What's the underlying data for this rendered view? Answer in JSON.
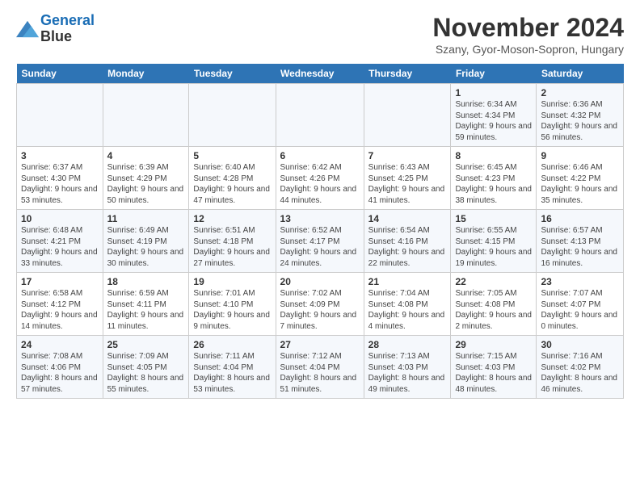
{
  "logo": {
    "line1": "General",
    "line2": "Blue"
  },
  "title": "November 2024",
  "subtitle": "Szany, Gyor-Moson-Sopron, Hungary",
  "days_of_week": [
    "Sunday",
    "Monday",
    "Tuesday",
    "Wednesday",
    "Thursday",
    "Friday",
    "Saturday"
  ],
  "weeks": [
    [
      {
        "num": "",
        "detail": ""
      },
      {
        "num": "",
        "detail": ""
      },
      {
        "num": "",
        "detail": ""
      },
      {
        "num": "",
        "detail": ""
      },
      {
        "num": "",
        "detail": ""
      },
      {
        "num": "1",
        "detail": "Sunrise: 6:34 AM\nSunset: 4:34 PM\nDaylight: 9 hours and 59 minutes."
      },
      {
        "num": "2",
        "detail": "Sunrise: 6:36 AM\nSunset: 4:32 PM\nDaylight: 9 hours and 56 minutes."
      }
    ],
    [
      {
        "num": "3",
        "detail": "Sunrise: 6:37 AM\nSunset: 4:30 PM\nDaylight: 9 hours and 53 minutes."
      },
      {
        "num": "4",
        "detail": "Sunrise: 6:39 AM\nSunset: 4:29 PM\nDaylight: 9 hours and 50 minutes."
      },
      {
        "num": "5",
        "detail": "Sunrise: 6:40 AM\nSunset: 4:28 PM\nDaylight: 9 hours and 47 minutes."
      },
      {
        "num": "6",
        "detail": "Sunrise: 6:42 AM\nSunset: 4:26 PM\nDaylight: 9 hours and 44 minutes."
      },
      {
        "num": "7",
        "detail": "Sunrise: 6:43 AM\nSunset: 4:25 PM\nDaylight: 9 hours and 41 minutes."
      },
      {
        "num": "8",
        "detail": "Sunrise: 6:45 AM\nSunset: 4:23 PM\nDaylight: 9 hours and 38 minutes."
      },
      {
        "num": "9",
        "detail": "Sunrise: 6:46 AM\nSunset: 4:22 PM\nDaylight: 9 hours and 35 minutes."
      }
    ],
    [
      {
        "num": "10",
        "detail": "Sunrise: 6:48 AM\nSunset: 4:21 PM\nDaylight: 9 hours and 33 minutes."
      },
      {
        "num": "11",
        "detail": "Sunrise: 6:49 AM\nSunset: 4:19 PM\nDaylight: 9 hours and 30 minutes."
      },
      {
        "num": "12",
        "detail": "Sunrise: 6:51 AM\nSunset: 4:18 PM\nDaylight: 9 hours and 27 minutes."
      },
      {
        "num": "13",
        "detail": "Sunrise: 6:52 AM\nSunset: 4:17 PM\nDaylight: 9 hours and 24 minutes."
      },
      {
        "num": "14",
        "detail": "Sunrise: 6:54 AM\nSunset: 4:16 PM\nDaylight: 9 hours and 22 minutes."
      },
      {
        "num": "15",
        "detail": "Sunrise: 6:55 AM\nSunset: 4:15 PM\nDaylight: 9 hours and 19 minutes."
      },
      {
        "num": "16",
        "detail": "Sunrise: 6:57 AM\nSunset: 4:13 PM\nDaylight: 9 hours and 16 minutes."
      }
    ],
    [
      {
        "num": "17",
        "detail": "Sunrise: 6:58 AM\nSunset: 4:12 PM\nDaylight: 9 hours and 14 minutes."
      },
      {
        "num": "18",
        "detail": "Sunrise: 6:59 AM\nSunset: 4:11 PM\nDaylight: 9 hours and 11 minutes."
      },
      {
        "num": "19",
        "detail": "Sunrise: 7:01 AM\nSunset: 4:10 PM\nDaylight: 9 hours and 9 minutes."
      },
      {
        "num": "20",
        "detail": "Sunrise: 7:02 AM\nSunset: 4:09 PM\nDaylight: 9 hours and 7 minutes."
      },
      {
        "num": "21",
        "detail": "Sunrise: 7:04 AM\nSunset: 4:08 PM\nDaylight: 9 hours and 4 minutes."
      },
      {
        "num": "22",
        "detail": "Sunrise: 7:05 AM\nSunset: 4:08 PM\nDaylight: 9 hours and 2 minutes."
      },
      {
        "num": "23",
        "detail": "Sunrise: 7:07 AM\nSunset: 4:07 PM\nDaylight: 9 hours and 0 minutes."
      }
    ],
    [
      {
        "num": "24",
        "detail": "Sunrise: 7:08 AM\nSunset: 4:06 PM\nDaylight: 8 hours and 57 minutes."
      },
      {
        "num": "25",
        "detail": "Sunrise: 7:09 AM\nSunset: 4:05 PM\nDaylight: 8 hours and 55 minutes."
      },
      {
        "num": "26",
        "detail": "Sunrise: 7:11 AM\nSunset: 4:04 PM\nDaylight: 8 hours and 53 minutes."
      },
      {
        "num": "27",
        "detail": "Sunrise: 7:12 AM\nSunset: 4:04 PM\nDaylight: 8 hours and 51 minutes."
      },
      {
        "num": "28",
        "detail": "Sunrise: 7:13 AM\nSunset: 4:03 PM\nDaylight: 8 hours and 49 minutes."
      },
      {
        "num": "29",
        "detail": "Sunrise: 7:15 AM\nSunset: 4:03 PM\nDaylight: 8 hours and 48 minutes."
      },
      {
        "num": "30",
        "detail": "Sunrise: 7:16 AM\nSunset: 4:02 PM\nDaylight: 8 hours and 46 minutes."
      }
    ]
  ]
}
